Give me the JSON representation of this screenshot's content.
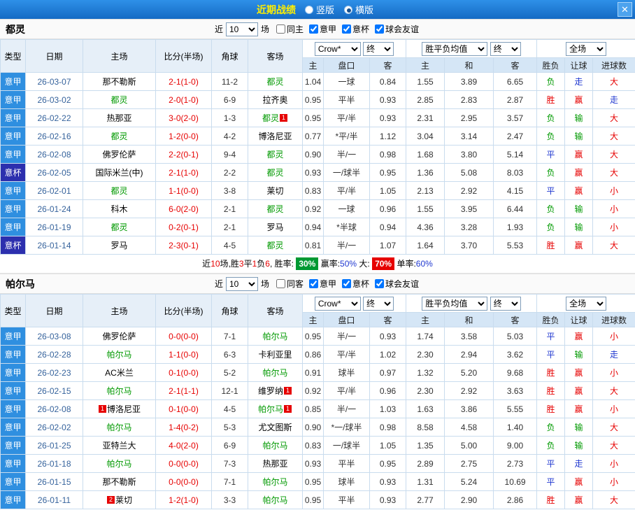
{
  "titlebar": {
    "title": "近期战绩",
    "radios": [
      {
        "label": "竖版",
        "checked": false
      },
      {
        "label": "横版",
        "checked": true
      }
    ],
    "close_icon": "✕"
  },
  "colors": {
    "league_serie_a_bg": "#2f8fe0",
    "league_cup_bg": "#2c2fae",
    "win_red": "#e60000",
    "loss_green": "#009900",
    "push_blue": "#2038d0",
    "selected_team_green": "#009900"
  },
  "sections": [
    {
      "team": "都灵",
      "filter": {
        "near": "近",
        "count": "10",
        "games": "场",
        "checkboxes": [
          {
            "label": "同主",
            "checked": false
          },
          {
            "label": "意甲",
            "checked": true
          },
          {
            "label": "意杯",
            "checked": true
          },
          {
            "label": "球会友谊",
            "checked": true
          }
        ]
      },
      "dropdowns": {
        "company": "Crow*",
        "state1": "终",
        "avg": "胜平负均值",
        "state2": "终",
        "scope": "全场"
      },
      "header": {
        "cols": [
          "类型",
          "日期",
          "主场",
          "比分(半场)",
          "角球",
          "客场"
        ],
        "sub": [
          "主",
          "盘口",
          "客",
          "主",
          "和",
          "客",
          "胜负",
          "让球",
          "进球数"
        ]
      },
      "rows": [
        {
          "league": "意甲",
          "league_cls": "jia",
          "date": "26-03-07",
          "home": {
            "name": "那不勒斯"
          },
          "score": "2-1(1-0)",
          "corner": "11-2",
          "away": {
            "name": "都灵",
            "selected": true
          },
          "odds": [
            "1.04",
            "一球",
            "0.84"
          ],
          "avg": [
            "1.55",
            "3.89",
            "6.65"
          ],
          "res": [
            [
              "负",
              "loss"
            ],
            [
              "走",
              "push"
            ],
            [
              "大",
              "big"
            ]
          ]
        },
        {
          "league": "意甲",
          "league_cls": "jia",
          "date": "26-03-02",
          "home": {
            "name": "都灵",
            "selected": true
          },
          "score": "2-0(1-0)",
          "corner": "6-9",
          "away": {
            "name": "拉齐奥"
          },
          "odds": [
            "0.95",
            "平半",
            "0.93"
          ],
          "avg": [
            "2.85",
            "2.83",
            "2.87"
          ],
          "res": [
            [
              "胜",
              "win"
            ],
            [
              "赢",
              "win"
            ],
            [
              "走",
              "push"
            ]
          ]
        },
        {
          "league": "意甲",
          "league_cls": "jia",
          "date": "26-02-22",
          "home": {
            "name": "热那亚"
          },
          "score": "3-0(2-0)",
          "corner": "1-3",
          "away": {
            "name": "都灵",
            "selected": true,
            "badge": "1",
            "badge_pos": "after"
          },
          "odds": [
            "0.95",
            "平/半",
            "0.93"
          ],
          "avg": [
            "2.31",
            "2.95",
            "3.57"
          ],
          "res": [
            [
              "负",
              "loss"
            ],
            [
              "输",
              "loss"
            ],
            [
              "大",
              "big"
            ]
          ]
        },
        {
          "league": "意甲",
          "league_cls": "jia",
          "date": "26-02-16",
          "home": {
            "name": "都灵",
            "selected": true
          },
          "score": "1-2(0-0)",
          "corner": "4-2",
          "away": {
            "name": "博洛尼亚"
          },
          "odds": [
            "0.77",
            "*平/半",
            "1.12"
          ],
          "avg": [
            "3.04",
            "3.14",
            "2.47"
          ],
          "res": [
            [
              "负",
              "loss"
            ],
            [
              "输",
              "loss"
            ],
            [
              "大",
              "big"
            ]
          ]
        },
        {
          "league": "意甲",
          "league_cls": "jia",
          "date": "26-02-08",
          "home": {
            "name": "佛罗伦萨"
          },
          "score": "2-2(0-1)",
          "corner": "9-4",
          "away": {
            "name": "都灵",
            "selected": true
          },
          "odds": [
            "0.90",
            "半/一",
            "0.98"
          ],
          "avg": [
            "1.68",
            "3.80",
            "5.14"
          ],
          "res": [
            [
              "平",
              "draw"
            ],
            [
              "赢",
              "win"
            ],
            [
              "大",
              "big"
            ]
          ]
        },
        {
          "league": "意杯",
          "league_cls": "bei",
          "date": "26-02-05",
          "home": {
            "name": "国际米兰(中)"
          },
          "score": "2-1(1-0)",
          "corner": "2-2",
          "away": {
            "name": "都灵",
            "selected": true
          },
          "odds": [
            "0.93",
            "一/球半",
            "0.95"
          ],
          "avg": [
            "1.36",
            "5.08",
            "8.03"
          ],
          "res": [
            [
              "负",
              "loss"
            ],
            [
              "赢",
              "win"
            ],
            [
              "大",
              "big"
            ]
          ]
        },
        {
          "league": "意甲",
          "league_cls": "jia",
          "date": "26-02-01",
          "home": {
            "name": "都灵",
            "selected": true
          },
          "score": "1-1(0-0)",
          "corner": "3-8",
          "away": {
            "name": "莱切"
          },
          "odds": [
            "0.83",
            "平/半",
            "1.05"
          ],
          "avg": [
            "2.13",
            "2.92",
            "4.15"
          ],
          "res": [
            [
              "平",
              "draw"
            ],
            [
              "赢",
              "win"
            ],
            [
              "小",
              "small"
            ]
          ]
        },
        {
          "league": "意甲",
          "league_cls": "jia",
          "date": "26-01-24",
          "home": {
            "name": "科木"
          },
          "score": "6-0(2-0)",
          "corner": "2-1",
          "away": {
            "name": "都灵",
            "selected": true
          },
          "odds": [
            "0.92",
            "一球",
            "0.96"
          ],
          "avg": [
            "1.55",
            "3.95",
            "6.44"
          ],
          "res": [
            [
              "负",
              "loss"
            ],
            [
              "输",
              "loss"
            ],
            [
              "小",
              "small"
            ]
          ]
        },
        {
          "league": "意甲",
          "league_cls": "jia",
          "date": "26-01-19",
          "home": {
            "name": "都灵",
            "selected": true
          },
          "score": "0-2(0-1)",
          "corner": "2-1",
          "away": {
            "name": "罗马"
          },
          "odds": [
            "0.94",
            "*半球",
            "0.94"
          ],
          "avg": [
            "4.36",
            "3.28",
            "1.93"
          ],
          "res": [
            [
              "负",
              "loss"
            ],
            [
              "输",
              "loss"
            ],
            [
              "小",
              "small"
            ]
          ]
        },
        {
          "league": "意杯",
          "league_cls": "bei",
          "date": "26-01-14",
          "home": {
            "name": "罗马"
          },
          "score": "2-3(0-1)",
          "corner": "4-5",
          "away": {
            "name": "都灵",
            "selected": true
          },
          "odds": [
            "0.81",
            "半/一",
            "1.07"
          ],
          "avg": [
            "1.64",
            "3.70",
            "5.53"
          ],
          "res": [
            [
              "胜",
              "win"
            ],
            [
              "赢",
              "win"
            ],
            [
              "大",
              "big"
            ]
          ]
        }
      ],
      "summary": [
        {
          "text": "近",
          "style": "plain"
        },
        {
          "text": "10",
          "style": "red"
        },
        {
          "text": "场,胜",
          "style": "plain"
        },
        {
          "text": "3",
          "style": "red"
        },
        {
          "text": "平",
          "style": "plain"
        },
        {
          "text": "1",
          "style": "red"
        },
        {
          "text": "负",
          "style": "plain"
        },
        {
          "text": "6",
          "style": "red"
        },
        {
          "text": ", 胜率: ",
          "style": "plain"
        },
        {
          "text": "30%",
          "style": "badge-green"
        },
        {
          "text": " 赢率:",
          "style": "plain"
        },
        {
          "text": "50%",
          "style": "blue"
        },
        {
          "text": " 大: ",
          "style": "plain"
        },
        {
          "text": "70%",
          "style": "badge-red"
        },
        {
          "text": " 单率:",
          "style": "plain"
        },
        {
          "text": "60%",
          "style": "blue"
        }
      ]
    },
    {
      "team": "帕尔马",
      "filter": {
        "near": "近",
        "count": "10",
        "games": "场",
        "checkboxes": [
          {
            "label": "同客",
            "checked": false
          },
          {
            "label": "意甲",
            "checked": true
          },
          {
            "label": "意杯",
            "checked": true
          },
          {
            "label": "球会友谊",
            "checked": true
          }
        ]
      },
      "dropdowns": {
        "company": "Crow*",
        "state1": "终",
        "avg": "胜平负均值",
        "state2": "终",
        "scope": "全场"
      },
      "header": {
        "cols": [
          "类型",
          "日期",
          "主场",
          "比分(半场)",
          "角球",
          "客场"
        ],
        "sub": [
          "主",
          "盘口",
          "客",
          "主",
          "和",
          "客",
          "胜负",
          "让球",
          "进球数"
        ]
      },
      "rows": [
        {
          "league": "意甲",
          "league_cls": "jia",
          "date": "26-03-08",
          "home": {
            "name": "佛罗伦萨"
          },
          "score": "0-0(0-0)",
          "corner": "7-1",
          "away": {
            "name": "帕尔马",
            "selected": true
          },
          "odds": [
            "0.95",
            "半/一",
            "0.93"
          ],
          "avg": [
            "1.74",
            "3.58",
            "5.03"
          ],
          "res": [
            [
              "平",
              "draw"
            ],
            [
              "赢",
              "win"
            ],
            [
              "小",
              "small"
            ]
          ]
        },
        {
          "league": "意甲",
          "league_cls": "jia",
          "date": "26-02-28",
          "home": {
            "name": "帕尔马",
            "selected": true
          },
          "score": "1-1(0-0)",
          "corner": "6-3",
          "away": {
            "name": "卡利亚里"
          },
          "odds": [
            "0.86",
            "平/半",
            "1.02"
          ],
          "avg": [
            "2.30",
            "2.94",
            "3.62"
          ],
          "res": [
            [
              "平",
              "draw"
            ],
            [
              "输",
              "loss"
            ],
            [
              "走",
              "push"
            ]
          ]
        },
        {
          "league": "意甲",
          "league_cls": "jia",
          "date": "26-02-23",
          "home": {
            "name": "AC米兰"
          },
          "score": "0-1(0-0)",
          "corner": "5-2",
          "away": {
            "name": "帕尔马",
            "selected": true
          },
          "odds": [
            "0.91",
            "球半",
            "0.97"
          ],
          "avg": [
            "1.32",
            "5.20",
            "9.68"
          ],
          "res": [
            [
              "胜",
              "win"
            ],
            [
              "赢",
              "win"
            ],
            [
              "小",
              "small"
            ]
          ]
        },
        {
          "league": "意甲",
          "league_cls": "jia",
          "date": "26-02-15",
          "home": {
            "name": "帕尔马",
            "selected": true
          },
          "score": "2-1(1-1)",
          "corner": "12-1",
          "away": {
            "name": "维罗纳",
            "badge": "1",
            "badge_pos": "after"
          },
          "odds": [
            "0.92",
            "平/半",
            "0.96"
          ],
          "avg": [
            "2.30",
            "2.92",
            "3.63"
          ],
          "res": [
            [
              "胜",
              "win"
            ],
            [
              "赢",
              "win"
            ],
            [
              "大",
              "big"
            ]
          ]
        },
        {
          "league": "意甲",
          "league_cls": "jia",
          "date": "26-02-08",
          "home": {
            "name": "博洛尼亚",
            "badge": "1",
            "badge_pos": "before"
          },
          "score": "0-1(0-0)",
          "corner": "4-5",
          "away": {
            "name": "帕尔马",
            "selected": true,
            "badge": "1",
            "badge_pos": "after"
          },
          "odds": [
            "0.85",
            "半/一",
            "1.03"
          ],
          "avg": [
            "1.63",
            "3.86",
            "5.55"
          ],
          "res": [
            [
              "胜",
              "win"
            ],
            [
              "赢",
              "win"
            ],
            [
              "小",
              "small"
            ]
          ]
        },
        {
          "league": "意甲",
          "league_cls": "jia",
          "date": "26-02-02",
          "home": {
            "name": "帕尔马",
            "selected": true
          },
          "score": "1-4(0-2)",
          "corner": "5-3",
          "away": {
            "name": "尤文图斯"
          },
          "odds": [
            "0.90",
            "*一/球半",
            "0.98"
          ],
          "avg": [
            "8.58",
            "4.58",
            "1.40"
          ],
          "res": [
            [
              "负",
              "loss"
            ],
            [
              "输",
              "loss"
            ],
            [
              "大",
              "big"
            ]
          ]
        },
        {
          "league": "意甲",
          "league_cls": "jia",
          "date": "26-01-25",
          "home": {
            "name": "亚特兰大"
          },
          "score": "4-0(2-0)",
          "corner": "6-9",
          "away": {
            "name": "帕尔马",
            "selected": true
          },
          "odds": [
            "0.83",
            "一/球半",
            "1.05"
          ],
          "avg": [
            "1.35",
            "5.00",
            "9.00"
          ],
          "res": [
            [
              "负",
              "loss"
            ],
            [
              "输",
              "loss"
            ],
            [
              "大",
              "big"
            ]
          ]
        },
        {
          "league": "意甲",
          "league_cls": "jia",
          "date": "26-01-18",
          "home": {
            "name": "帕尔马",
            "selected": true
          },
          "score": "0-0(0-0)",
          "corner": "7-3",
          "away": {
            "name": "热那亚"
          },
          "odds": [
            "0.93",
            "平半",
            "0.95"
          ],
          "avg": [
            "2.89",
            "2.75",
            "2.73"
          ],
          "res": [
            [
              "平",
              "draw"
            ],
            [
              "走",
              "push"
            ],
            [
              "小",
              "small"
            ]
          ]
        },
        {
          "league": "意甲",
          "league_cls": "jia",
          "date": "26-01-15",
          "home": {
            "name": "那不勒斯"
          },
          "score": "0-0(0-0)",
          "corner": "7-1",
          "away": {
            "name": "帕尔马",
            "selected": true
          },
          "odds": [
            "0.95",
            "球半",
            "0.93"
          ],
          "avg": [
            "1.31",
            "5.24",
            "10.69"
          ],
          "res": [
            [
              "平",
              "draw"
            ],
            [
              "赢",
              "win"
            ],
            [
              "小",
              "small"
            ]
          ]
        },
        {
          "league": "意甲",
          "league_cls": "jia",
          "date": "26-01-11",
          "home": {
            "name": "莱切",
            "badge": "2",
            "badge_pos": "before"
          },
          "score": "1-2(1-0)",
          "corner": "3-3",
          "away": {
            "name": "帕尔马",
            "selected": true
          },
          "odds": [
            "0.95",
            "平半",
            "0.93"
          ],
          "avg": [
            "2.77",
            "2.90",
            "2.86"
          ],
          "res": [
            [
              "胜",
              "win"
            ],
            [
              "赢",
              "win"
            ],
            [
              "大",
              "big"
            ]
          ]
        }
      ],
      "summary": []
    }
  ]
}
